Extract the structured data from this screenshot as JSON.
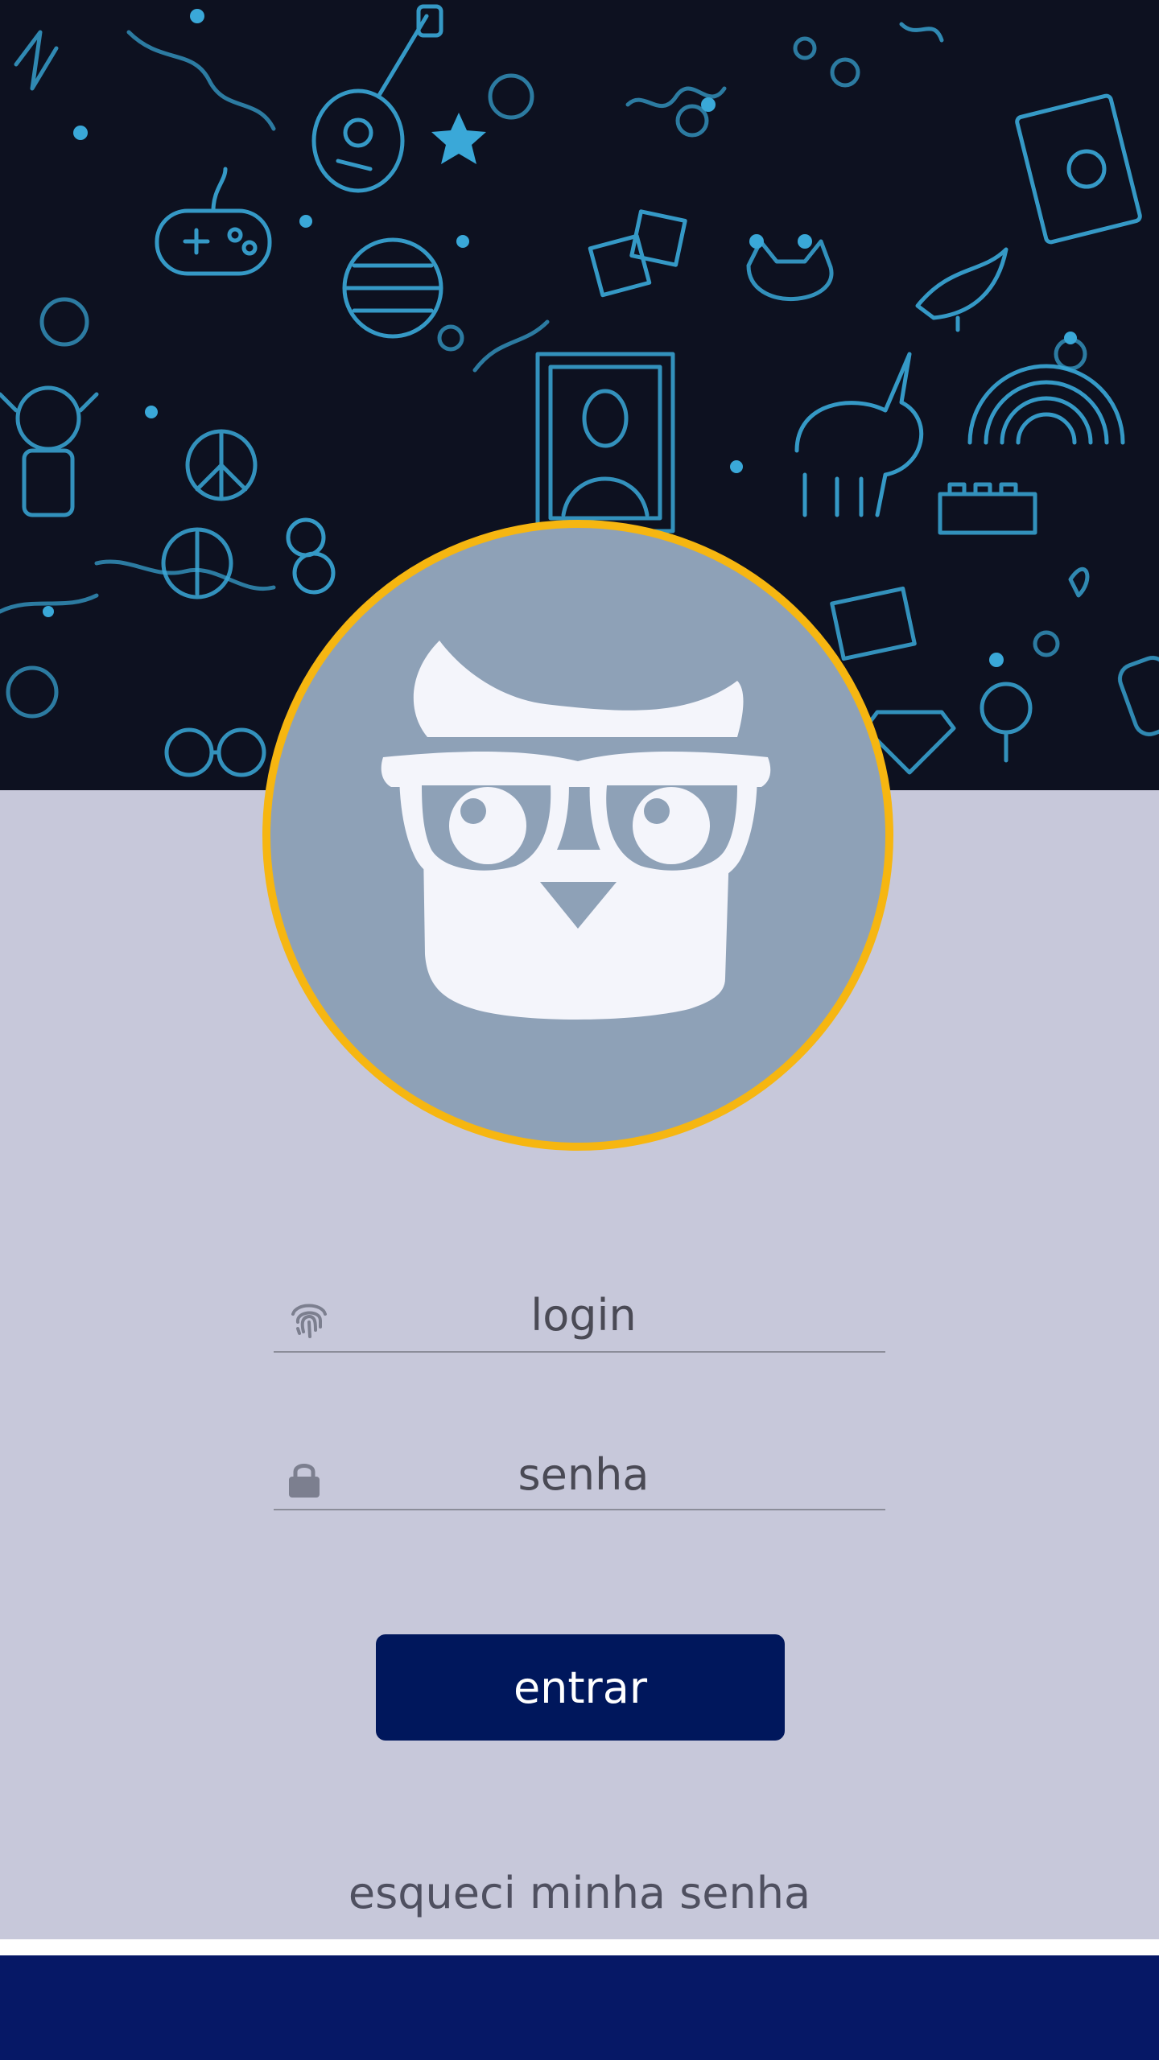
{
  "login": {
    "placeholder": "login",
    "username_icon": "fingerprint-icon"
  },
  "password": {
    "placeholder": "senha",
    "icon": "lock-icon"
  },
  "actions": {
    "submit_label": "entrar",
    "forgot_label": "esqueci minha senha"
  },
  "avatar": {
    "icon": "owl-with-glasses-icon"
  },
  "colors": {
    "hero_background": "#0d1120",
    "doodle": "#3aa8d8",
    "form_background": "#c7c8da",
    "avatar_fill": "#8ea1b7",
    "avatar_ring": "#f6b611",
    "button": "#00175c",
    "bottom_bar": "#061866"
  }
}
